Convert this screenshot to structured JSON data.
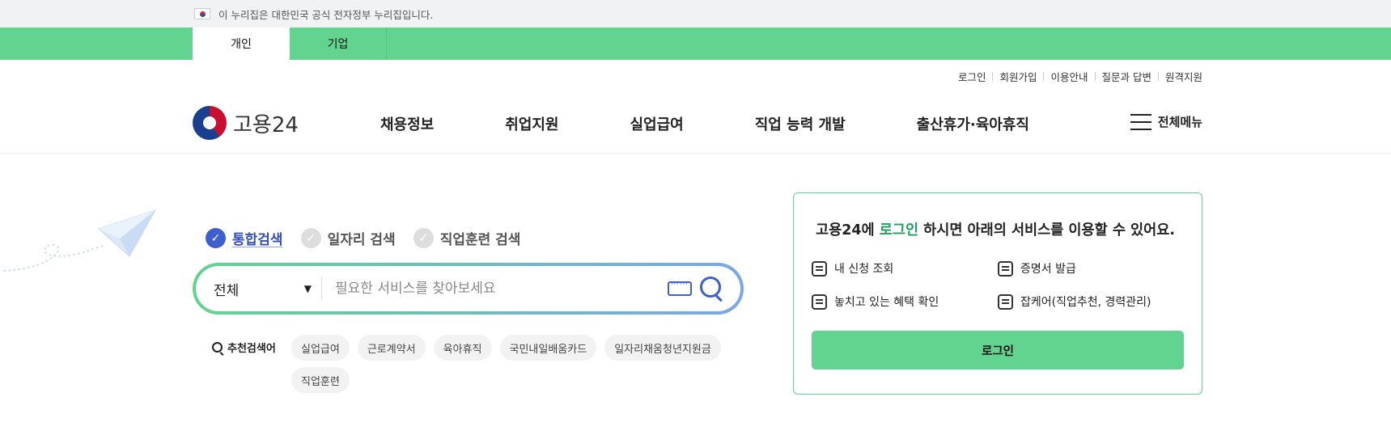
{
  "gov_banner": {
    "text": "이 누리집은 대한민국 공식 전자정부 누리집입니다."
  },
  "user_tabs": [
    "개인",
    "기업"
  ],
  "util_links": [
    "로그인",
    "회원가입",
    "이용안내",
    "질문과 답변",
    "원격지원"
  ],
  "logo": {
    "text": "고용24"
  },
  "nav": [
    "채용정보",
    "취업지원",
    "실업급여",
    "직업 능력 개발",
    "출산휴가·육아휴직"
  ],
  "all_menu": "전체메뉴",
  "search": {
    "tabs": [
      "통합검색",
      "일자리 검색",
      "직업훈련 검색"
    ],
    "active_tab": 0,
    "category": "전체",
    "placeholder": "필요한 서비스를 찾아보세요",
    "recommend_title": "추천검색어",
    "keywords": [
      "실업급여",
      "근로계약서",
      "육아휴직",
      "국민내일배움카드",
      "일자리채움청년지원금",
      "직업훈련"
    ]
  },
  "login_card": {
    "title_pre": "고용24에 ",
    "title_hl": "로그인",
    "title_post": " 하시면 아래의 서비스를 이용할 수 있어요.",
    "services": [
      "내 신청 조회",
      "증명서 발급",
      "놓치고 있는 혜택 확인",
      "잡케어(직업추천, 경력관리)"
    ],
    "button": "로그인"
  },
  "colors": {
    "brand_green": "#62d490",
    "accent_blue": "#3f5fcf",
    "highlight_green": "#20a060"
  },
  "icons": [
    "korea-flag-icon",
    "logo-taegeuk-icon",
    "hamburger-icon",
    "check-circle-icon",
    "caret-down-icon",
    "keyboard-icon",
    "search-icon",
    "paper-plane-icon",
    "list-icon",
    "certificate-icon",
    "benefit-icon",
    "jobcare-icon"
  ]
}
